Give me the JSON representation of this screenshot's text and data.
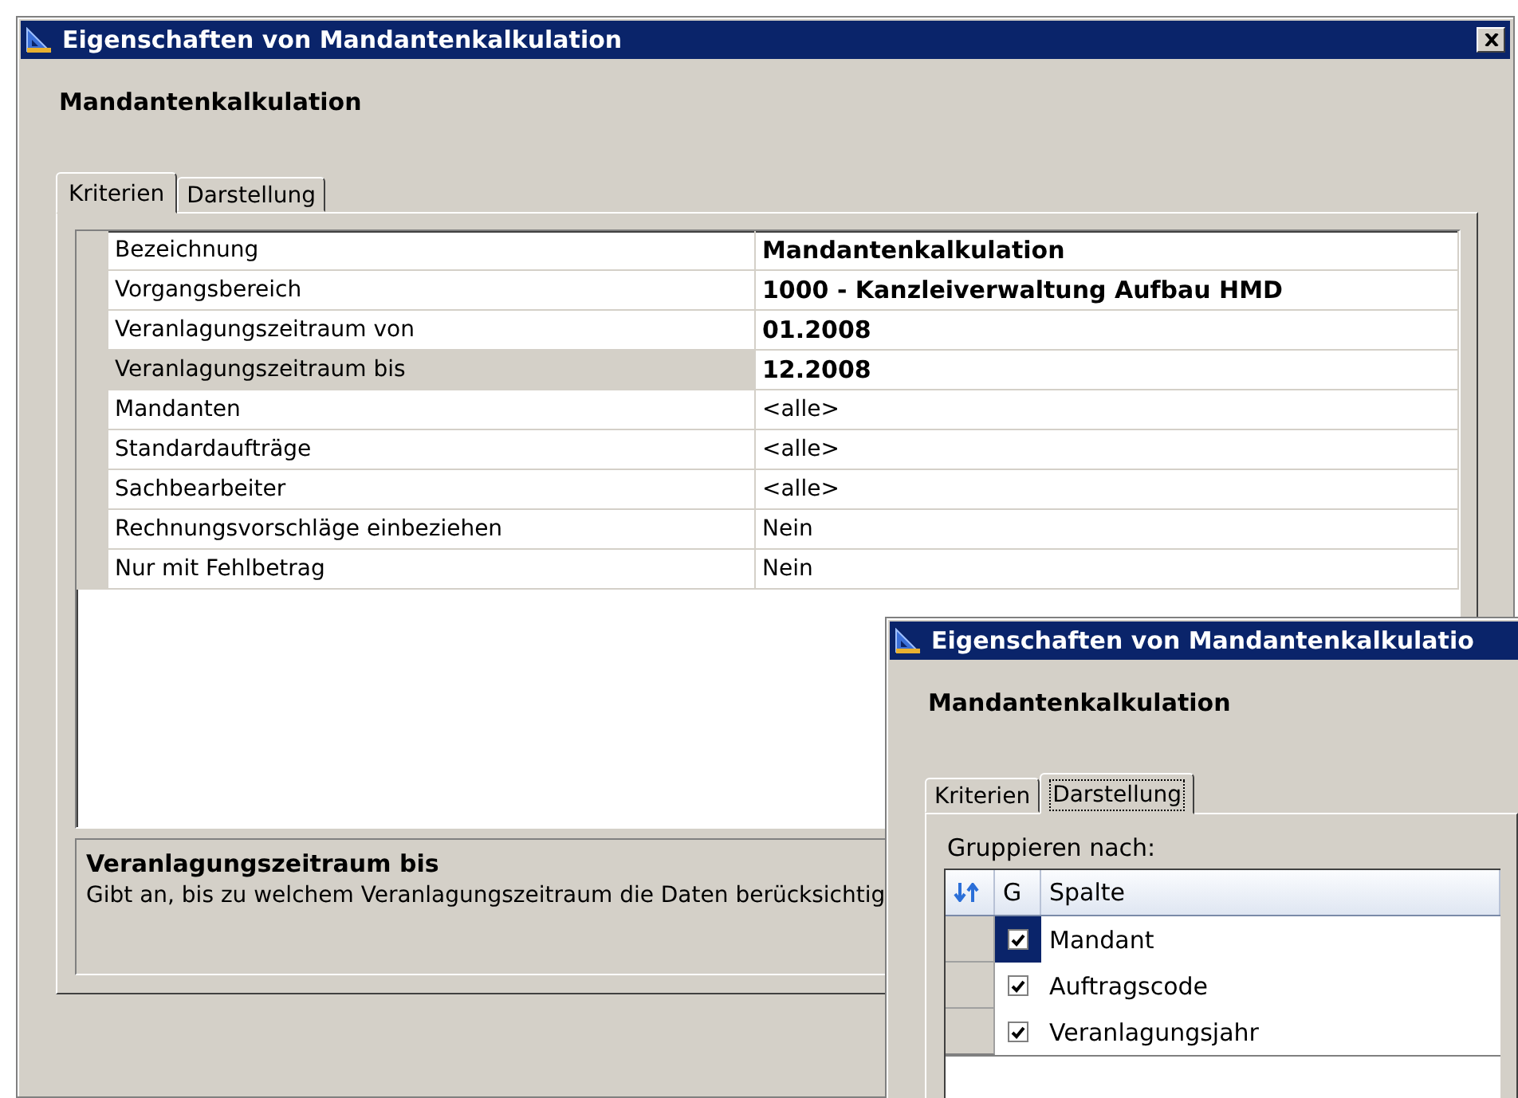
{
  "windows": [
    {
      "title": "Eigenschaften von Mandantenkalkulation",
      "closable": true,
      "heading": "Mandantenkalkulation",
      "tabs": [
        {
          "label": "Kriterien",
          "selected": true
        },
        {
          "label": "Darstellung",
          "selected": false
        }
      ],
      "content": {
        "kind": "criteria",
        "properties": [
          {
            "label": "Bezeichnung",
            "value": "Mandantenkalkulation",
            "bold": true,
            "selected": false
          },
          {
            "label": "Vorgangsbereich",
            "value": "1000 - Kanzleiverwaltung Aufbau HMD",
            "bold": true,
            "selected": false
          },
          {
            "label": "Veranlagungszeitraum von",
            "value": "01.2008",
            "bold": true,
            "selected": false
          },
          {
            "label": "Veranlagungszeitraum bis",
            "value": "12.2008",
            "bold": true,
            "selected": true
          },
          {
            "label": "Mandanten",
            "value": "<alle>",
            "bold": false,
            "selected": false
          },
          {
            "label": "Standardaufträge",
            "value": "<alle>",
            "bold": false,
            "selected": false
          },
          {
            "label": "Sachbearbeiter",
            "value": "<alle>",
            "bold": false,
            "selected": false
          },
          {
            "label": "Rechnungsvorschläge einbeziehen",
            "value": "Nein",
            "bold": false,
            "selected": false
          },
          {
            "label": "Nur mit Fehlbetrag",
            "value": "Nein",
            "bold": false,
            "selected": false
          }
        ],
        "description": {
          "title": "Veranlagungszeitraum bis",
          "text": "Gibt an, bis zu welchem Veranlagungszeitraum die Daten berücksichtig"
        }
      }
    },
    {
      "title": "Eigenschaften von Mandantenkalkulatio",
      "closable": false,
      "heading": "Mandantenkalkulation",
      "tabs": [
        {
          "label": "Kriterien",
          "selected": false
        },
        {
          "label": "Darstellung",
          "selected": true
        }
      ],
      "content": {
        "kind": "display",
        "group_label": "Gruppieren nach:",
        "columns": [
          "G",
          "Spalte"
        ],
        "rows": [
          {
            "name": "Mandant",
            "checked": true,
            "selected": true
          },
          {
            "name": "Auftragscode",
            "checked": true,
            "selected": false
          },
          {
            "name": "Veranlagungsjahr",
            "checked": true,
            "selected": false
          }
        ]
      }
    }
  ]
}
